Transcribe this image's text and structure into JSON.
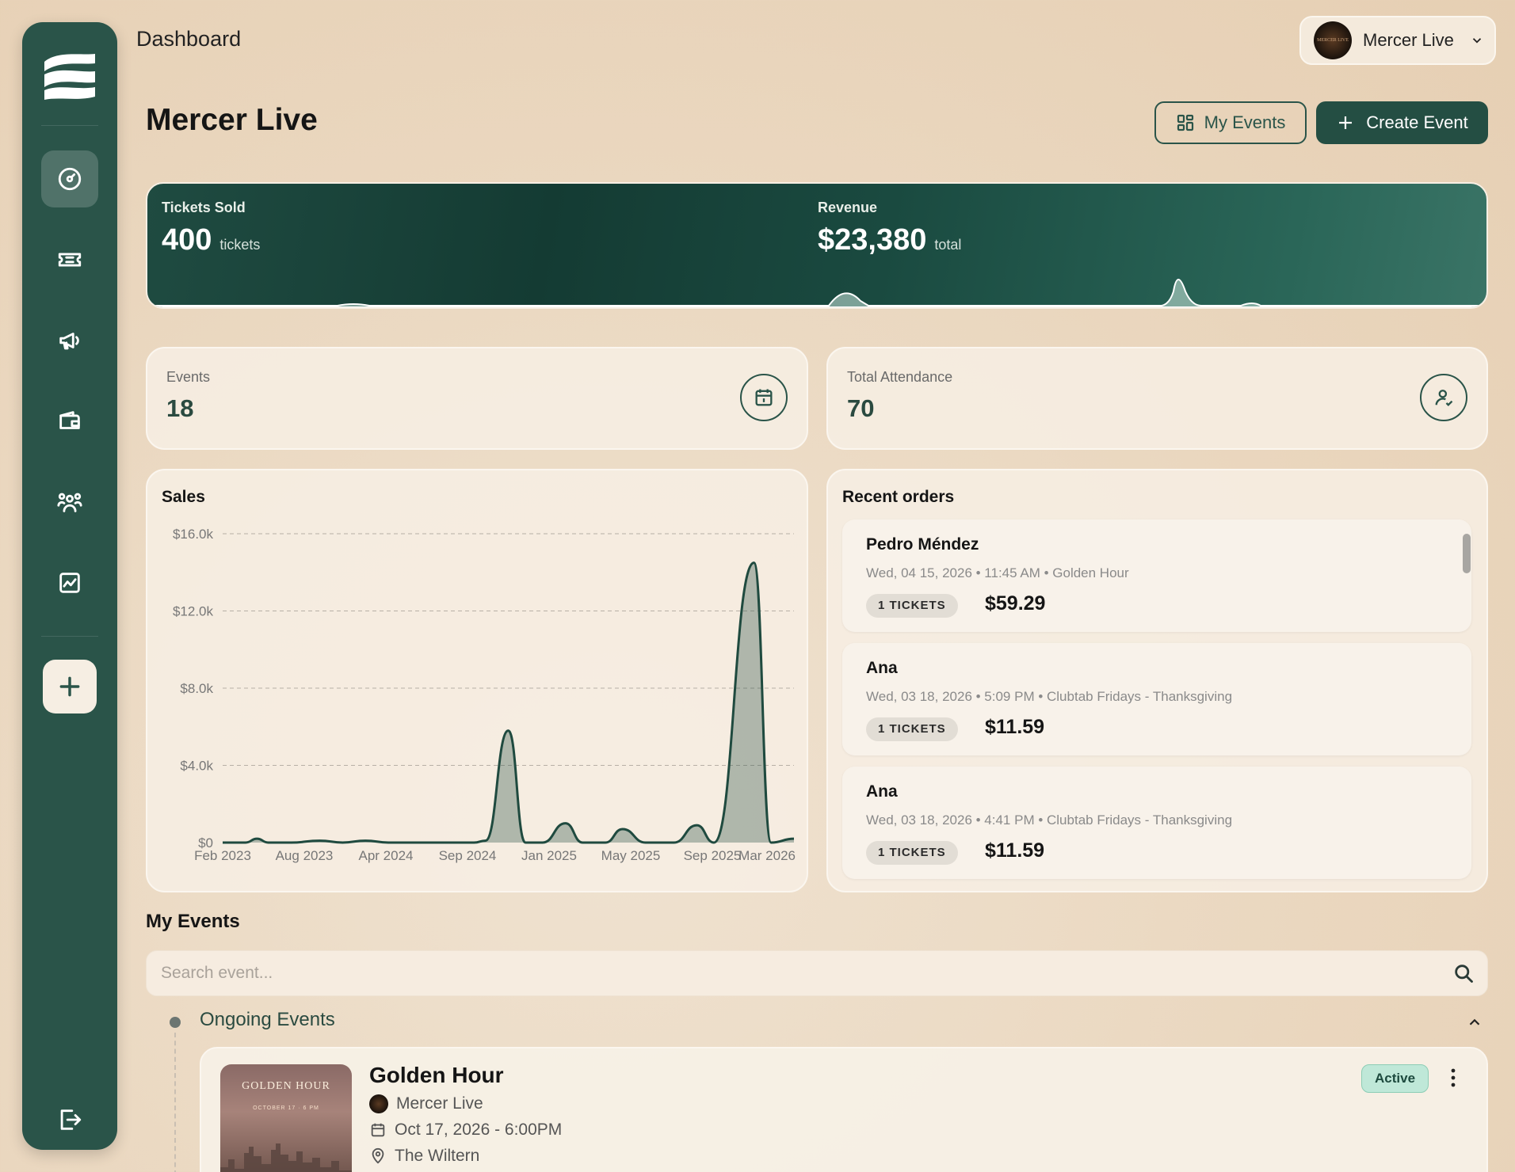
{
  "breadcrumb": "Dashboard",
  "account": {
    "name": "Mercer Live",
    "avatar_text": "MERCER LIVE"
  },
  "page_title": "Mercer Live",
  "actions": {
    "my_events": "My Events",
    "create_event": "Create Event"
  },
  "sidebar": {
    "items": [
      {
        "name": "dashboard-icon",
        "active": true
      },
      {
        "name": "ticket-icon",
        "active": false
      },
      {
        "name": "megaphone-icon",
        "active": false
      },
      {
        "name": "wallet-icon",
        "active": false
      },
      {
        "name": "users-icon",
        "active": false
      },
      {
        "name": "analytics-icon",
        "active": false
      }
    ],
    "add_icon": "plus-icon",
    "logout_icon": "logout-icon"
  },
  "hero": {
    "tickets_label": "Tickets Sold",
    "tickets_value": "400",
    "tickets_unit": "tickets",
    "revenue_label": "Revenue",
    "revenue_value": "$23,380",
    "revenue_unit": "total"
  },
  "stats": {
    "events_label": "Events",
    "events_value": "18",
    "attendance_label": "Total Attendance",
    "attendance_value": "70"
  },
  "sales": {
    "title": "Sales"
  },
  "chart_data": {
    "type": "area",
    "title": "Sales",
    "y_ticks": [
      "$16.0k",
      "$12.0k",
      "$8.0k",
      "$4.0k",
      "$0"
    ],
    "ylim": [
      0,
      16000
    ],
    "x_ticks": [
      "Feb 2023",
      "Aug 2023",
      "Apr 2024",
      "Sep 2024",
      "Jan 2025",
      "May 2025",
      "Sep 2025",
      "Mar 2026"
    ],
    "points": [
      [
        0,
        0
      ],
      [
        0.04,
        0
      ],
      [
        0.06,
        200
      ],
      [
        0.08,
        0
      ],
      [
        0.12,
        0
      ],
      [
        0.17,
        100
      ],
      [
        0.21,
        0
      ],
      [
        0.25,
        100
      ],
      [
        0.29,
        0
      ],
      [
        0.33,
        0
      ],
      [
        0.37,
        0
      ],
      [
        0.44,
        0
      ],
      [
        0.46,
        100
      ],
      [
        0.5,
        5800
      ],
      [
        0.53,
        0
      ],
      [
        0.56,
        0
      ],
      [
        0.6,
        1000
      ],
      [
        0.63,
        0
      ],
      [
        0.67,
        0
      ],
      [
        0.7,
        700
      ],
      [
        0.74,
        0
      ],
      [
        0.79,
        0
      ],
      [
        0.83,
        900
      ],
      [
        0.86,
        0
      ],
      [
        0.93,
        14500
      ],
      [
        0.96,
        0
      ],
      [
        1,
        200
      ]
    ],
    "grid": true
  },
  "orders": {
    "title": "Recent orders",
    "items": [
      {
        "name": "Pedro Méndez",
        "meta": "Wed, 04 15, 2026 • 11:45 AM • Golden Hour",
        "tickets": "1 TICKETS",
        "amount": "$59.29"
      },
      {
        "name": "Ana",
        "meta": "Wed, 03 18, 2026 • 5:09 PM • Clubtab Fridays - Thanksgiving",
        "tickets": "1 TICKETS",
        "amount": "$11.59"
      },
      {
        "name": "Ana",
        "meta": "Wed, 03 18, 2026 • 4:41 PM • Clubtab Fridays - Thanksgiving",
        "tickets": "1 TICKETS",
        "amount": "$11.59"
      }
    ]
  },
  "my_events": {
    "title": "My Events",
    "search_placeholder": "Search event...",
    "group_label": "Ongoing Events",
    "event": {
      "title": "Golden Hour",
      "organizer": "Mercer Live",
      "date": "Oct 17, 2026 - 6:00PM",
      "venue": "The Wiltern",
      "status": "Active",
      "poster_title": "GOLDEN HOUR",
      "poster_sub": "OCTOBER 17 · 6 PM"
    }
  },
  "colors": {
    "sidebar": "#2a5449",
    "accent": "#244e43",
    "badge": "#bfe8d8"
  }
}
